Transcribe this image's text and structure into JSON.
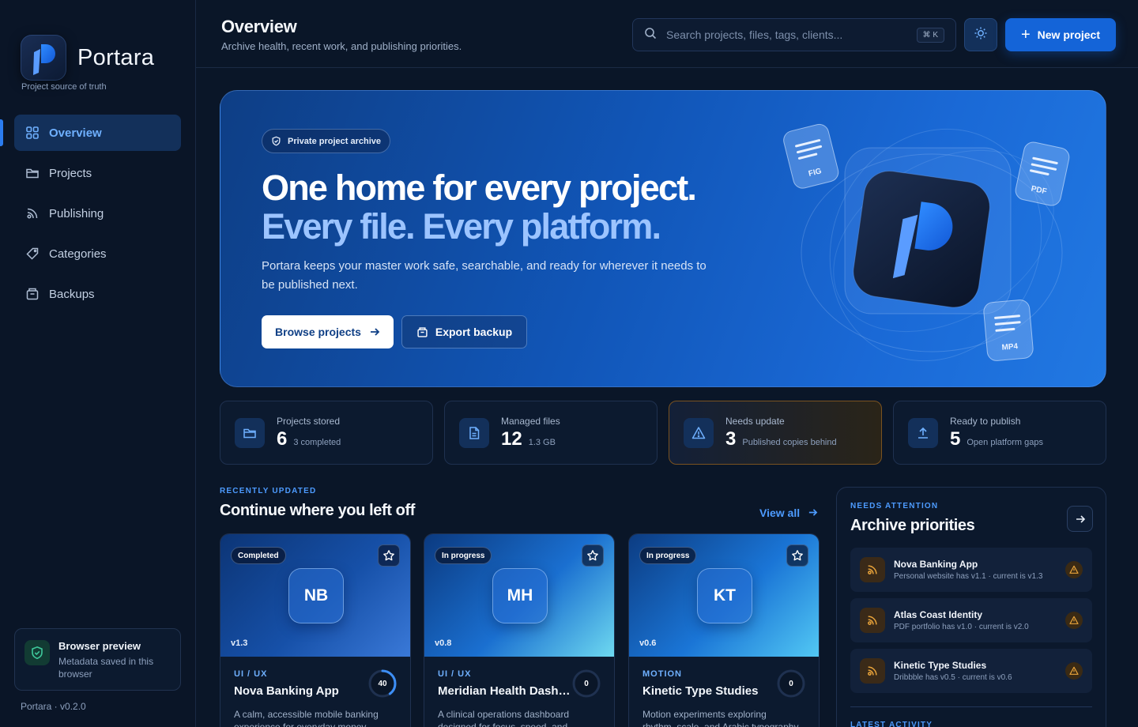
{
  "brand": {
    "name": "Portara",
    "tagline": "Project source of truth"
  },
  "nav": [
    {
      "label": "Overview",
      "icon": "grid-icon",
      "active": true
    },
    {
      "label": "Projects",
      "icon": "folder-icon"
    },
    {
      "label": "Publishing",
      "icon": "publish-icon"
    },
    {
      "label": "Categories",
      "icon": "tag-icon"
    },
    {
      "label": "Backups",
      "icon": "archive-box-icon"
    }
  ],
  "preview": {
    "title": "Browser preview",
    "subtitle": "Metadata saved in this browser"
  },
  "version": "Portara · v0.2.0",
  "header": {
    "title": "Overview",
    "subtitle": "Archive health, recent work, and publishing priorities.",
    "search_placeholder": "Search projects, files, tags, clients...",
    "shortcut": "⌘ K",
    "new_project": "New project"
  },
  "hero": {
    "pill": "Private project archive",
    "headline": "One home for every project.",
    "headline_accent": "Every file. Every platform.",
    "body": "Portara keeps your master work safe, searchable, and ready for wherever it needs to be published next.",
    "browse": "Browse projects",
    "export": "Export backup",
    "file_tags": [
      "FIG",
      "PDF",
      "MP4"
    ]
  },
  "stats": [
    {
      "label": "Projects stored",
      "value": "6",
      "sub": "3 completed",
      "icon": "folder-icon"
    },
    {
      "label": "Managed files",
      "value": "12",
      "sub": "1.3 GB",
      "icon": "file-icon"
    },
    {
      "label": "Needs update",
      "value": "3",
      "sub": "Published copies behind",
      "icon": "warning-icon"
    },
    {
      "label": "Ready to publish",
      "value": "5",
      "sub": "Open platform gaps",
      "icon": "upload-icon"
    }
  ],
  "recent": {
    "kicker": "RECENTLY UPDATED",
    "title": "Continue where you left off",
    "view_all": "View all",
    "cards": [
      {
        "status": "Completed",
        "initials": "NB",
        "version": "v1.3",
        "category": "UI / UX",
        "name": "Nova Banking App",
        "desc": "A calm, accessible mobile banking experience for everyday money",
        "progress": 40
      },
      {
        "status": "In progress",
        "initials": "MH",
        "version": "v0.8",
        "category": "UI / UX",
        "name": "Meridian Health Dashboard",
        "desc": "A clinical operations dashboard designed for focus, speed, and",
        "progress": 0
      },
      {
        "status": "In progress",
        "initials": "KT",
        "version": "v0.6",
        "category": "MOTION",
        "name": "Kinetic Type Studies",
        "desc": "Motion experiments exploring rhythm, scale, and Arabic typography",
        "progress": 0
      }
    ]
  },
  "attention": {
    "kicker": "NEEDS ATTENTION",
    "title": "Archive priorities",
    "items": [
      {
        "title": "Nova Banking App",
        "sub": "Personal website has v1.1 · current is v1.3"
      },
      {
        "title": "Atlas Coast Identity",
        "sub": "PDF portfolio has v1.0 · current is v2.0"
      },
      {
        "title": "Kinetic Type Studies",
        "sub": "Dribbble has v0.5 · current is v0.6"
      }
    ],
    "latest_kicker": "LATEST ACTIVITY"
  },
  "colors": {
    "accent": "#1464d8",
    "accent_text": "#4d9bff",
    "warning": "#e8a33a",
    "background": "#0a1628"
  }
}
